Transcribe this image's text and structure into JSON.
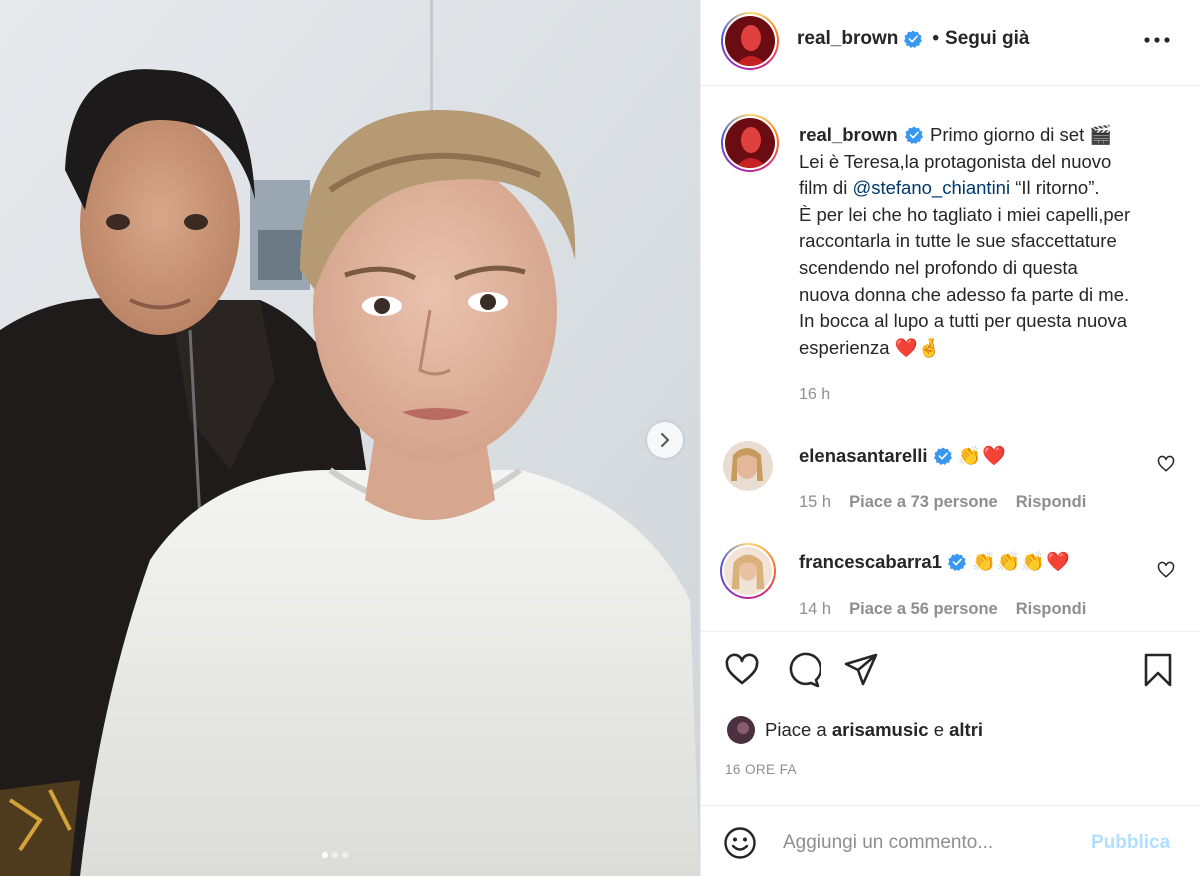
{
  "post": {
    "username": "real_brown",
    "separator": "•",
    "follow_status": "Segui già",
    "caption_lines": [
      "Primo giorno di set 🎬",
      "Lei è Teresa,la protagonista del nuovo",
      "film di ",
      "@stefano_chiantini",
      " “Il ritorno”.",
      "È per lei che ho tagliato i miei capelli,per",
      "raccontarla in tutte le sue sfaccettature",
      "scendendo nel profondo di questa",
      "nuova donna che adesso fa parte di me.",
      "In bocca al lupo a tutti per questa nuova",
      "esperienza ❤️🤞"
    ],
    "caption_time": "16 h"
  },
  "comments": [
    {
      "username": "elenasantarelli",
      "text": "👏❤️",
      "time": "15 h",
      "likes": "Piace a 73 persone",
      "reply": "Rispondi"
    },
    {
      "username": "francescabarra1",
      "text": "👏👏👏❤️",
      "time": "14 h",
      "likes": "Piace a 56 persone",
      "reply": "Rispondi"
    }
  ],
  "likes": {
    "prefix": "Piace a",
    "user": "arisamusic",
    "mid": "e",
    "others": "altri"
  },
  "post_age": "16 ORE FA",
  "comment_box": {
    "placeholder": "Aggiungi un commento...",
    "publish": "Pubblica"
  },
  "colors": {
    "verified": "#3897f0",
    "link": "#00376b",
    "secondary_text": "#8e8e8e",
    "publish_disabled": "#b2dffc"
  },
  "icons": [
    "verified-badge-icon",
    "more-options-icon",
    "heart-icon",
    "comment-icon",
    "share-icon",
    "bookmark-icon",
    "emoji-icon",
    "chevron-right-icon"
  ],
  "carousel": {
    "current": 1,
    "total": 3
  }
}
